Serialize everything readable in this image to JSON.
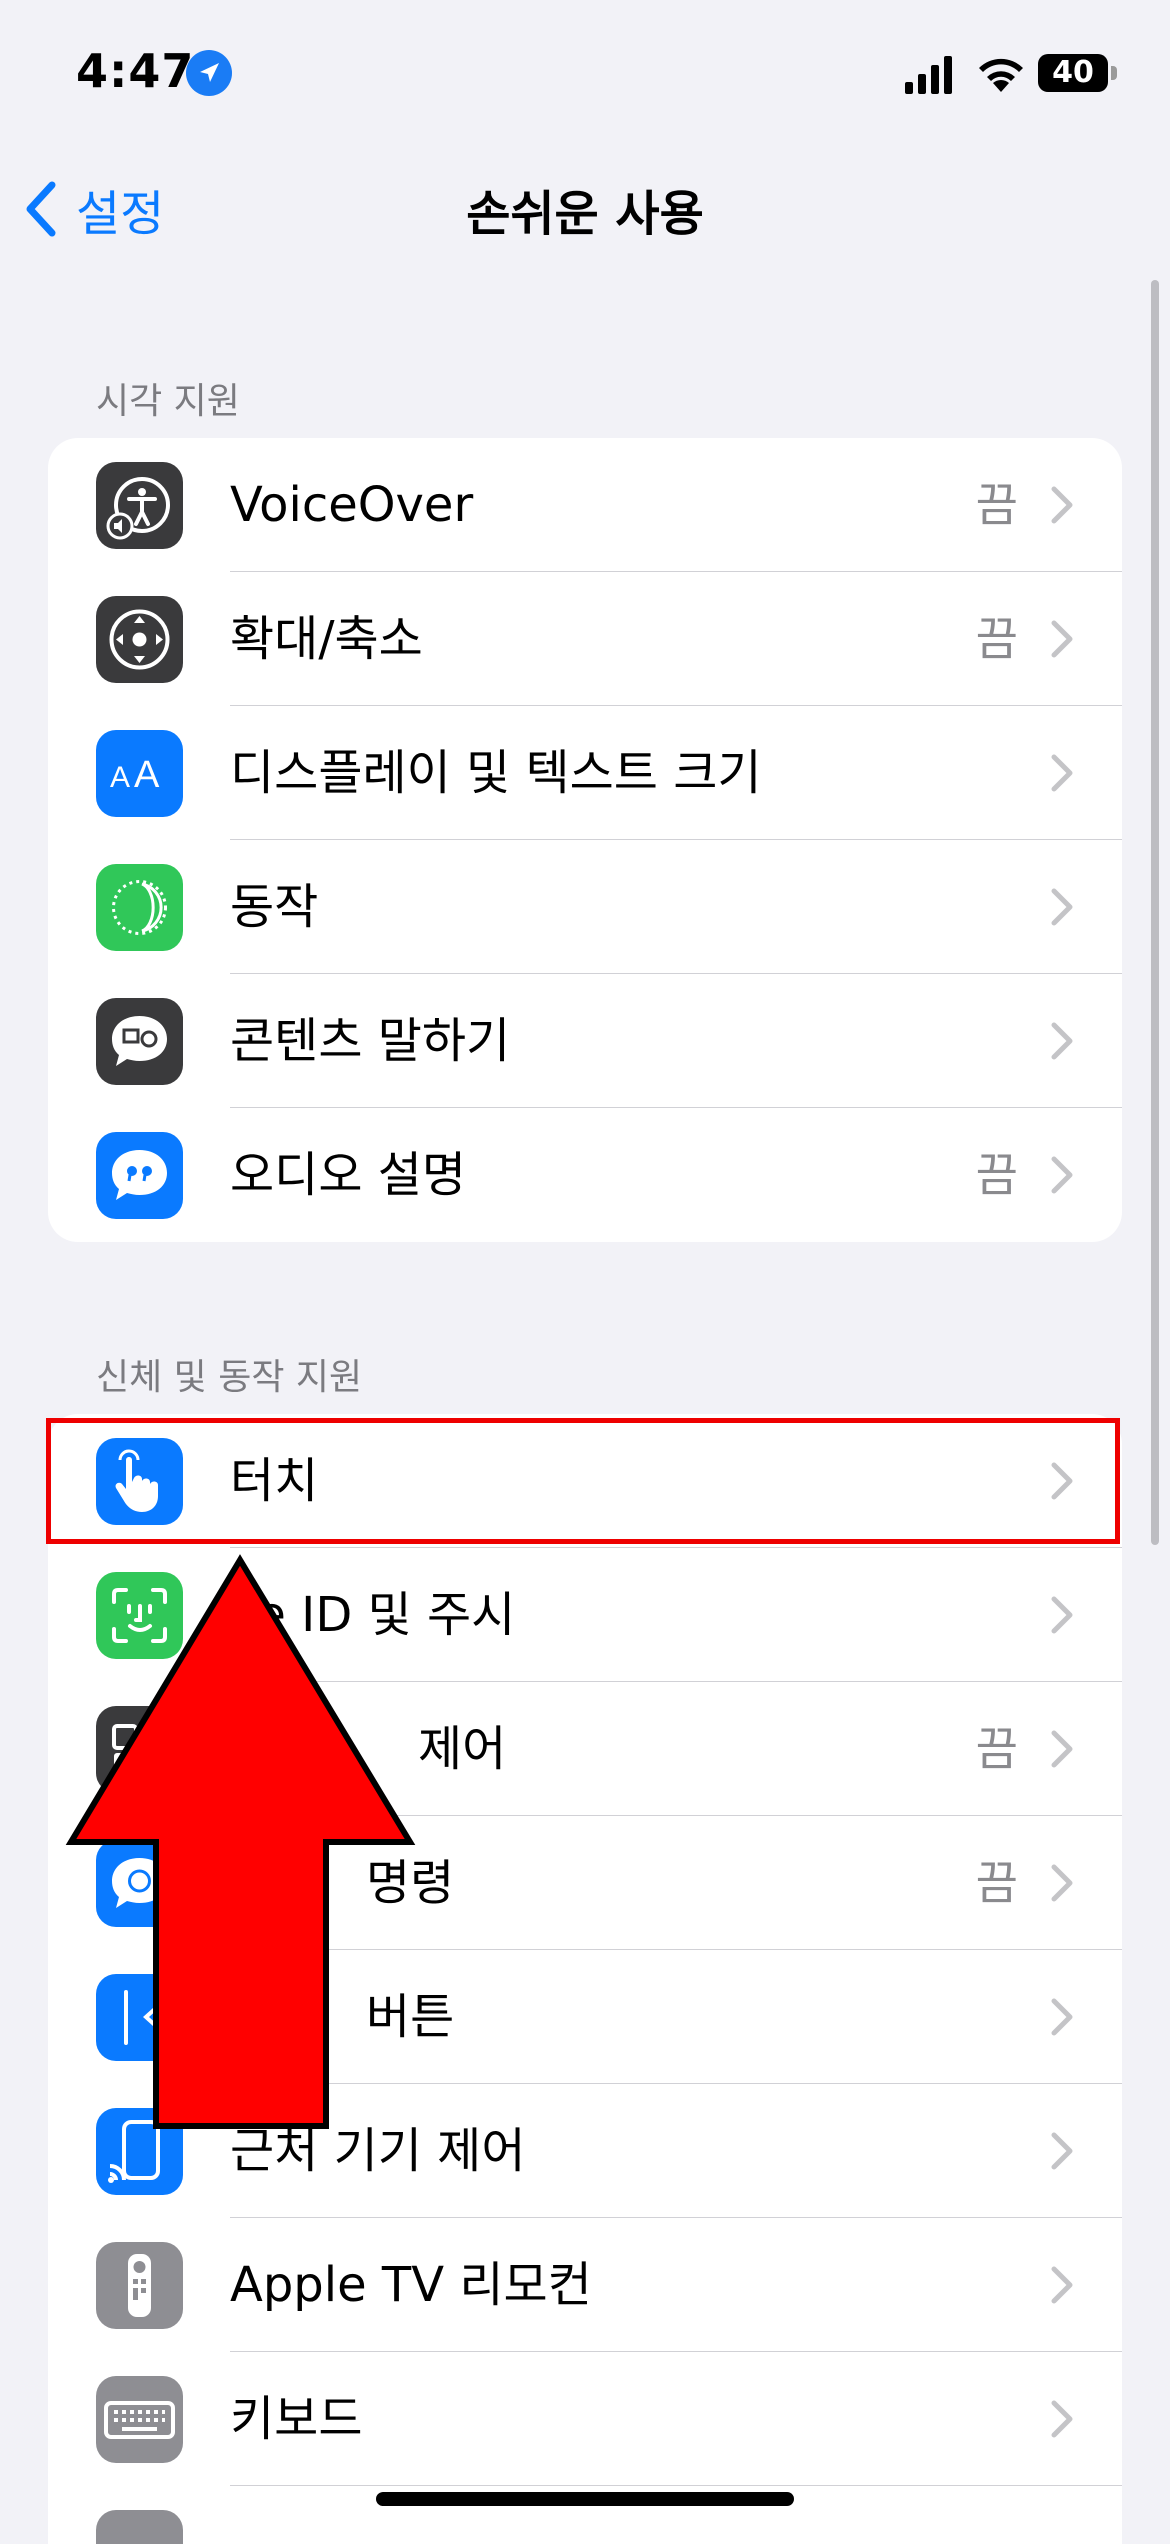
{
  "status_bar": {
    "time": "4:47",
    "battery": "40"
  },
  "nav": {
    "back_label": "설정",
    "title": "손쉬운 사용"
  },
  "sections": [
    {
      "header": "시각 지원",
      "items": [
        {
          "icon": "voiceover-icon",
          "label": "VoiceOver",
          "value": "끔"
        },
        {
          "icon": "zoom-icon",
          "label": "확대/축소",
          "value": "끔"
        },
        {
          "icon": "text-size-icon",
          "label": "디스플레이 및 텍스트 크기",
          "value": ""
        },
        {
          "icon": "motion-icon",
          "label": "동작",
          "value": ""
        },
        {
          "icon": "spoken-content-icon",
          "label": "콘텐츠 말하기",
          "value": ""
        },
        {
          "icon": "audio-description-icon",
          "label": "오디오 설명",
          "value": "끔"
        }
      ]
    },
    {
      "header": "신체 및 동작 지원",
      "items": [
        {
          "icon": "touch-hand-icon",
          "label": "터치",
          "value": ""
        },
        {
          "icon": "face-id-icon",
          "label": "ce ID 및 주시",
          "value": ""
        },
        {
          "icon": "switch-control-icon",
          "label": "제어",
          "value": "끔"
        },
        {
          "icon": "voice-control-icon",
          "label": "명령",
          "value": "끔"
        },
        {
          "icon": "side-button-icon",
          "label": "버튼",
          "value": ""
        },
        {
          "icon": "nearby-device-icon",
          "label": "근처 기기 제어",
          "value": ""
        },
        {
          "icon": "apple-tv-remote-icon",
          "label": "Apple TV 리모컨",
          "value": ""
        },
        {
          "icon": "keyboard-icon",
          "label": "키보드",
          "value": ""
        },
        {
          "icon": "generic-icon",
          "label": "",
          "value": ""
        }
      ]
    }
  ],
  "colors": {
    "accent": "#0a7aff",
    "highlight": "#ee0000",
    "arrow": "#ff0000"
  }
}
